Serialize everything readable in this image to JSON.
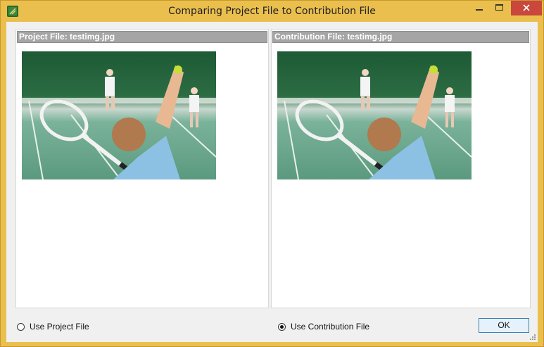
{
  "window": {
    "title": "Comparing Project File to Contribution File"
  },
  "panes": {
    "project": {
      "header": "Project File: testimg.jpg"
    },
    "contribution": {
      "header": "Contribution File: testimg.jpg"
    }
  },
  "options": {
    "use_project": {
      "label": "Use Project File",
      "checked": false
    },
    "use_contribution": {
      "label": "Use Contribution File",
      "checked": true
    }
  },
  "buttons": {
    "ok": "OK"
  },
  "colors": {
    "frame": "#eabf4e",
    "close": "#c9473c",
    "header": "#a5a5a5"
  }
}
